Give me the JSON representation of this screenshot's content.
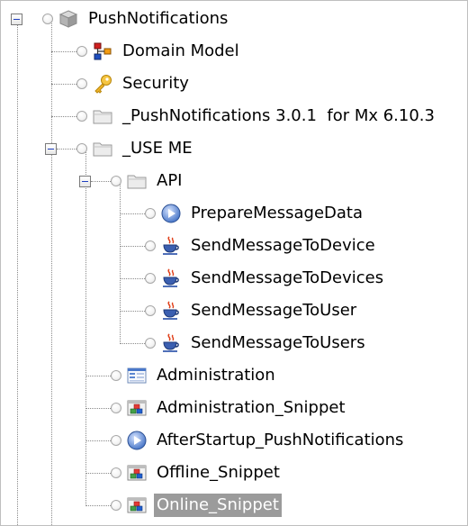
{
  "tree": {
    "root": {
      "label": "PushNotifications",
      "icon": "module-box-icon",
      "expanded": true
    },
    "items": [
      {
        "label": "Domain Model",
        "icon": "domain-model-icon"
      },
      {
        "label": "Security",
        "icon": "key-icon"
      },
      {
        "label": "_PushNotifications 3.0.1  for Mx 6.10.3",
        "icon": "folder-icon"
      },
      {
        "label": "_USE ME",
        "icon": "folder-icon",
        "expanded": true
      },
      {
        "label": "API",
        "icon": "folder-icon",
        "expanded": true
      },
      {
        "label": "PrepareMessageData",
        "icon": "microflow-icon"
      },
      {
        "label": "SendMessageToDevice",
        "icon": "java-action-icon"
      },
      {
        "label": "SendMessageToDevices",
        "icon": "java-action-icon"
      },
      {
        "label": "SendMessageToUser",
        "icon": "java-action-icon"
      },
      {
        "label": "SendMessageToUsers",
        "icon": "java-action-icon"
      },
      {
        "label": "Administration",
        "icon": "page-icon"
      },
      {
        "label": "Administration_Snippet",
        "icon": "snippet-icon"
      },
      {
        "label": "AfterStartup_PushNotifications",
        "icon": "microflow-icon"
      },
      {
        "label": "Offline_Snippet",
        "icon": "snippet-icon"
      },
      {
        "label": "Online_Snippet",
        "icon": "snippet-icon",
        "selected": true
      }
    ]
  }
}
